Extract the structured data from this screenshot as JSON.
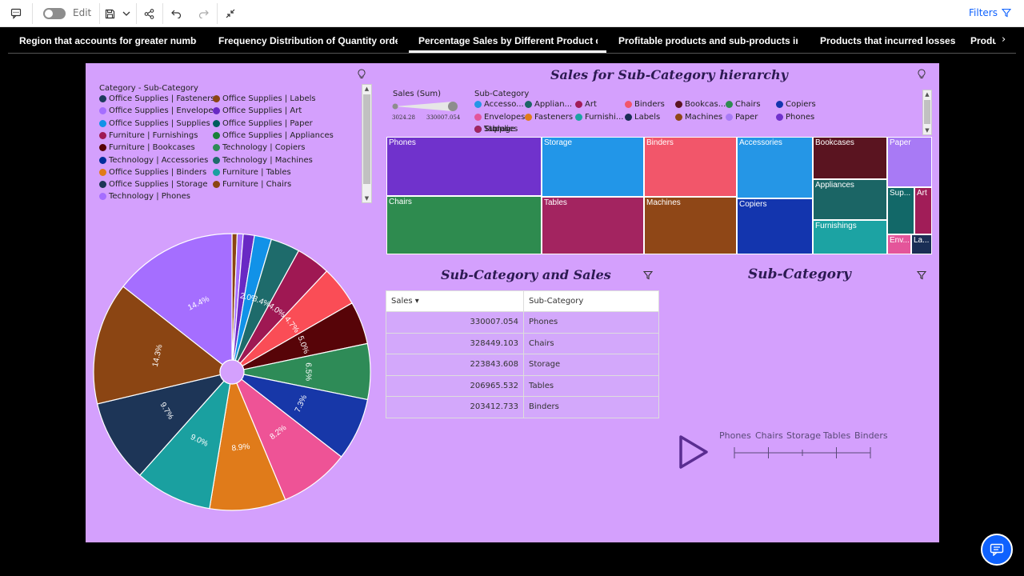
{
  "toolbar": {
    "edit_label": "Edit",
    "filters_label": "Filters"
  },
  "tabs": [
    {
      "label": "Region that accounts for greater number o"
    },
    {
      "label": "Frequency Distribution of Quantity ordere"
    },
    {
      "label": "Percentage Sales by Different Product cat"
    },
    {
      "label": "Profitable products and sub-products in la"
    },
    {
      "label": "Products that incurred losses"
    },
    {
      "label": "Produ"
    }
  ],
  "pie_legend": {
    "title": "Category - Sub-Category",
    "items": [
      {
        "label": "Office Supplies | Fasteners",
        "color": "#1d3a5c"
      },
      {
        "label": "Office Supplies | Labels",
        "color": "#8b4513"
      },
      {
        "label": "Office Supplies | Envelopes",
        "color": "#a56eff"
      },
      {
        "label": "Office Supplies | Art",
        "color": "#6929c4"
      },
      {
        "label": "Office Supplies | Supplies",
        "color": "#1192e8"
      },
      {
        "label": "Office Supplies | Paper",
        "color": "#005d5d"
      },
      {
        "label": "Furniture | Furnishings",
        "color": "#9f1853"
      },
      {
        "label": "Office Supplies | Appliances",
        "color": "#198038"
      },
      {
        "label": "Furniture | Bookcases",
        "color": "#570408"
      },
      {
        "label": "Technology | Copiers",
        "color": "#2e8b57"
      },
      {
        "label": "Technology | Accessories",
        "color": "#002d9c"
      },
      {
        "label": "Technology | Machines",
        "color": "#1e6b6b"
      },
      {
        "label": "Office Supplies | Binders",
        "color": "#e07b1a"
      },
      {
        "label": "Furniture | Tables",
        "color": "#1aa0a0"
      },
      {
        "label": "Office Supplies | Storage",
        "color": "#1d3557"
      },
      {
        "label": "Furniture | Chairs",
        "color": "#8b4513"
      },
      {
        "label": "Technology | Phones",
        "color": "#a56eff"
      }
    ]
  },
  "chart_data": [
    {
      "type": "pie",
      "slices": [
        {
          "label": "",
          "value": 0.6,
          "color": "#8b4513"
        },
        {
          "label": "",
          "value": 0.7,
          "color": "#a56eff"
        },
        {
          "label": "",
          "value": 1.3,
          "color": "#6929c4"
        },
        {
          "label": "2.0%",
          "value": 2.0,
          "color": "#1192e8"
        },
        {
          "label": "3.4%",
          "value": 3.4,
          "color": "#1e6b6b"
        },
        {
          "label": "4.0%",
          "value": 4.0,
          "color": "#9f1853"
        },
        {
          "label": "4.7%",
          "value": 4.7,
          "color": "#fa4d56"
        },
        {
          "label": "5.0%",
          "value": 5.0,
          "color": "#570408"
        },
        {
          "label": "6.5%",
          "value": 6.5,
          "color": "#2e8b57"
        },
        {
          "label": "7.3%",
          "value": 7.3,
          "color": "#1737a8"
        },
        {
          "label": "8.2%",
          "value": 8.2,
          "color": "#ee5396"
        },
        {
          "label": "8.9%",
          "value": 8.9,
          "color": "#e07b1a"
        },
        {
          "label": "9.0%",
          "value": 9.0,
          "color": "#1aa0a0"
        },
        {
          "label": "9.7%",
          "value": 9.7,
          "color": "#1d3557"
        },
        {
          "label": "14.3%",
          "value": 14.3,
          "color": "#8b4513"
        },
        {
          "label": "14.4%",
          "value": 14.4,
          "color": "#a56eff"
        }
      ]
    },
    {
      "type": "heatmap",
      "title": "Sales for Sub-Category hierarchy",
      "cells": [
        {
          "label": "Phones",
          "value": 330007.054,
          "color": "#7032cc"
        },
        {
          "label": "Chairs",
          "value": 328449.103,
          "color": "#2e8b4f"
        },
        {
          "label": "Storage",
          "value": 223843.608,
          "color": "#2296e8"
        },
        {
          "label": "Tables",
          "value": 206965.532,
          "color": "#a32460"
        },
        {
          "label": "Binders",
          "value": 203412.733,
          "color": "#f2566a"
        },
        {
          "label": "Machines",
          "value": 189238.631,
          "color": "#8f4717"
        },
        {
          "label": "Accessories",
          "value": 167380.318,
          "color": "#2596e6"
        },
        {
          "label": "Copiers",
          "value": 149528.03,
          "color": "#1335ae"
        },
        {
          "label": "Bookcases",
          "value": 114879.996,
          "color": "#5a1420"
        },
        {
          "label": "Appliances",
          "value": 107532.161,
          "color": "#1b6565"
        },
        {
          "label": "Furnishings",
          "value": 91705.164,
          "color": "#1ca3a3"
        },
        {
          "label": "Paper",
          "value": 78479.206,
          "color": "#a87af5"
        },
        {
          "label": "Sup...",
          "value": 46673.538,
          "color": "#126868"
        },
        {
          "label": "Art",
          "value": 27118.792,
          "color": "#a11d58"
        },
        {
          "label": "Env...",
          "value": 16476.402,
          "color": "#e4559a"
        },
        {
          "label": "La...",
          "value": 12486.312,
          "color": "#1a2e55"
        }
      ]
    }
  ],
  "treemap": {
    "size_legend": {
      "label": "Sales (Sum)",
      "min": "3024.28",
      "max": "330007.054"
    },
    "color_legend_title": "Sub-Category",
    "color_legend": [
      {
        "label": "Accesso...",
        "color": "#2596e6"
      },
      {
        "label": "Applian...",
        "color": "#1b6565"
      },
      {
        "label": "Art",
        "color": "#a11d58"
      },
      {
        "label": "Binders",
        "color": "#f2566a"
      },
      {
        "label": "Bookcas...",
        "color": "#5a1420"
      },
      {
        "label": "Chairs",
        "color": "#2e8b4f"
      },
      {
        "label": "Copiers",
        "color": "#1335ae"
      },
      {
        "label": "Envelopes",
        "color": "#e4559a"
      },
      {
        "label": "Fasteners",
        "color": "#e07b1a"
      },
      {
        "label": "Furnishi...",
        "color": "#1ca3a3"
      },
      {
        "label": "Labels",
        "color": "#1a2e55"
      },
      {
        "label": "Machines",
        "color": "#8f4717"
      },
      {
        "label": "Paper",
        "color": "#a87af5"
      },
      {
        "label": "Phones",
        "color": "#7032cc"
      },
      {
        "label": "Storage",
        "color": "#2296e8"
      },
      {
        "label": "Supplies",
        "color": "#126868"
      },
      {
        "label": "Tables",
        "color": "#a32460"
      }
    ]
  },
  "table": {
    "title": "Sub-Category and Sales",
    "headers": [
      "Sales ▾",
      "Sub-Category"
    ],
    "rows": [
      {
        "sales": "330007.054",
        "subcat": "Phones"
      },
      {
        "sales": "328449.103",
        "subcat": "Chairs"
      },
      {
        "sales": "223843.608",
        "subcat": "Storage"
      },
      {
        "sales": "206965.532",
        "subcat": "Tables"
      },
      {
        "sales": "203412.733",
        "subcat": "Binders"
      }
    ]
  },
  "selector": {
    "title": "Sub-Category",
    "labels": [
      "Phones",
      "Chairs",
      "Storage",
      "Tables",
      "Binders"
    ]
  }
}
